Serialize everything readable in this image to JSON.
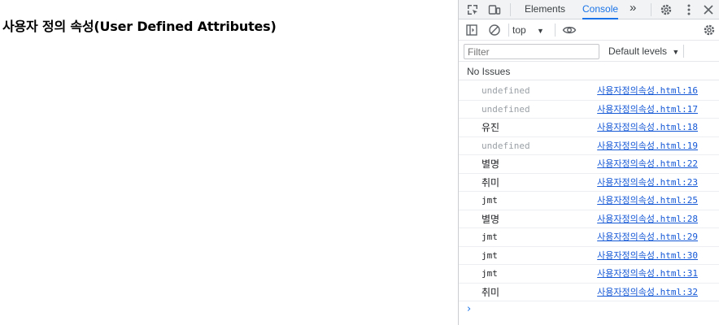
{
  "page": {
    "title": "사용자 정의 속성(User Defined Attributes)"
  },
  "devtools": {
    "tabs": [
      {
        "label": "Elements",
        "active": false
      },
      {
        "label": "Console",
        "active": true
      }
    ],
    "more_tabs": "»",
    "context": "top",
    "filter_placeholder": "Filter",
    "levels_label": "Default levels",
    "issues_label": "No Issues",
    "accent_color": "#1a73e8",
    "prompt_symbol": "›"
  },
  "console": {
    "messages": [
      {
        "text": "undefined",
        "kind": "undef",
        "source": "사용자정의속성.html:16"
      },
      {
        "text": "undefined",
        "kind": "undef",
        "source": "사용자정의속성.html:17"
      },
      {
        "text": "유진",
        "kind": "kor",
        "source": "사용자정의속성.html:18"
      },
      {
        "text": "undefined",
        "kind": "undef",
        "source": "사용자정의속성.html:19"
      },
      {
        "text": "별명",
        "kind": "kor",
        "source": "사용자정의속성.html:22"
      },
      {
        "text": "취미",
        "kind": "kor",
        "source": "사용자정의속성.html:23"
      },
      {
        "text": "jmt",
        "kind": "str",
        "source": "사용자정의속성.html:25"
      },
      {
        "text": "별명",
        "kind": "kor",
        "source": "사용자정의속성.html:28"
      },
      {
        "text": "jmt",
        "kind": "str",
        "source": "사용자정의속성.html:29"
      },
      {
        "text": "jmt",
        "kind": "str",
        "source": "사용자정의속성.html:30"
      },
      {
        "text": "jmt",
        "kind": "str",
        "source": "사용자정의속성.html:31"
      },
      {
        "text": "취미",
        "kind": "kor",
        "source": "사용자정의속성.html:32"
      }
    ]
  }
}
